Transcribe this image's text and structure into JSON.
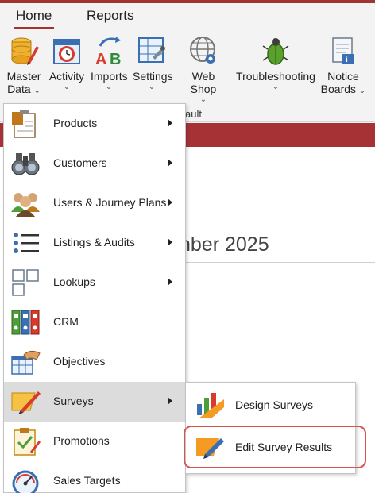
{
  "ribbon_tabs": [
    {
      "label": "Home",
      "active": true
    },
    {
      "label": "Reports",
      "active": false
    }
  ],
  "ribbon_buttons": [
    {
      "line1": "Master",
      "line2": "Data",
      "icon": "database-pencil-icon"
    },
    {
      "line1": "Activity",
      "line2": "",
      "icon": "calendar-clock-icon"
    },
    {
      "line1": "Imports",
      "line2": "",
      "icon": "ab-import-icon"
    },
    {
      "line1": "Settings",
      "line2": "",
      "icon": "settings-table-icon"
    },
    {
      "line1": "Web Shop",
      "line2": "",
      "icon": "globe-icon"
    },
    {
      "line1": "Troubleshooting",
      "line2": "",
      "icon": "bug-icon"
    },
    {
      "line1": "Notice",
      "line2": "Boards",
      "icon": "notice-board-icon"
    }
  ],
  "ribbon_group_label": "ault",
  "content_heading_fragment": "nber 2025",
  "menu_items": [
    {
      "label": "Products",
      "has_submenu": true,
      "icon": "clipboard-icon"
    },
    {
      "label": "Customers",
      "has_submenu": true,
      "icon": "binoculars-icon"
    },
    {
      "label": "Users & Journey Plans",
      "has_submenu": true,
      "icon": "users-group-icon"
    },
    {
      "label": "Listings & Audits",
      "has_submenu": true,
      "icon": "list-icon"
    },
    {
      "label": "Lookups",
      "has_submenu": true,
      "icon": "squares-icon"
    },
    {
      "label": "CRM",
      "has_submenu": false,
      "icon": "binders-icon"
    },
    {
      "label": "Objectives",
      "has_submenu": false,
      "icon": "handshake-calendar-icon"
    },
    {
      "label": "Surveys",
      "has_submenu": true,
      "icon": "survey-pencil-icon",
      "highlighted": true
    },
    {
      "label": "Promotions",
      "has_submenu": false,
      "icon": "clipboard-check-icon"
    },
    {
      "label": "Sales Targets",
      "has_submenu": false,
      "icon": "gauge-icon"
    }
  ],
  "submenu_items": [
    {
      "label": "Design Surveys",
      "icon": "bar-chart-ruler-icon"
    },
    {
      "label": "Edit Survey Results",
      "icon": "edit-survey-icon",
      "callout": true
    }
  ],
  "colors": {
    "accent": "#a0342f",
    "title_band": "#a63236",
    "highlight": "#dcdcdc",
    "callout": "#d9534f"
  }
}
